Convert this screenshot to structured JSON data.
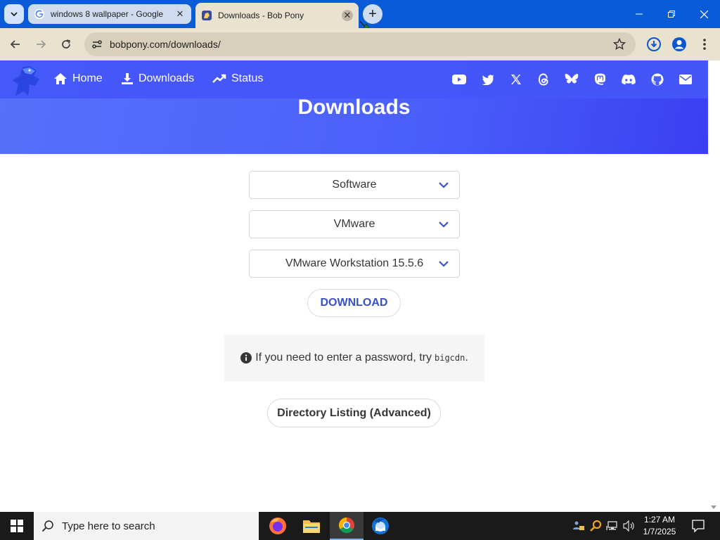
{
  "browser": {
    "tabs": [
      {
        "title": "windows 8 wallpaper - Google",
        "active": false
      },
      {
        "title": "Downloads - Bob Pony",
        "active": true
      }
    ],
    "url": "bobpony.com/downloads/",
    "accent_color": "#0a5bd8",
    "toolbar_color": "#e9e2cf"
  },
  "site": {
    "nav": {
      "home_label": "Home",
      "downloads_label": "Downloads",
      "status_label": "Status"
    },
    "social_icons": [
      "youtube-icon",
      "twitter-icon",
      "x-icon",
      "threads-icon",
      "bluesky-icon",
      "mastodon-icon",
      "discord-icon",
      "github-icon",
      "mail-icon"
    ],
    "page_title": "Downloads",
    "hero_color": "#4a5ffa",
    "selects": {
      "category": "Software",
      "vendor": "VMware",
      "product": "VMware Workstation 15.5.6"
    },
    "download_label": "DOWNLOAD",
    "notice": {
      "text": "If you need to enter a password, try",
      "code": "bigcdn",
      "suffix": "."
    },
    "directory_label": "Directory Listing (Advanced)"
  },
  "taskbar": {
    "search_placeholder": "Type here to search",
    "apps": [
      "firefox-icon",
      "file-explorer-icon",
      "chrome-icon",
      "thunderbird-icon"
    ],
    "time": "1:27 AM",
    "date": "1/7/2025"
  }
}
